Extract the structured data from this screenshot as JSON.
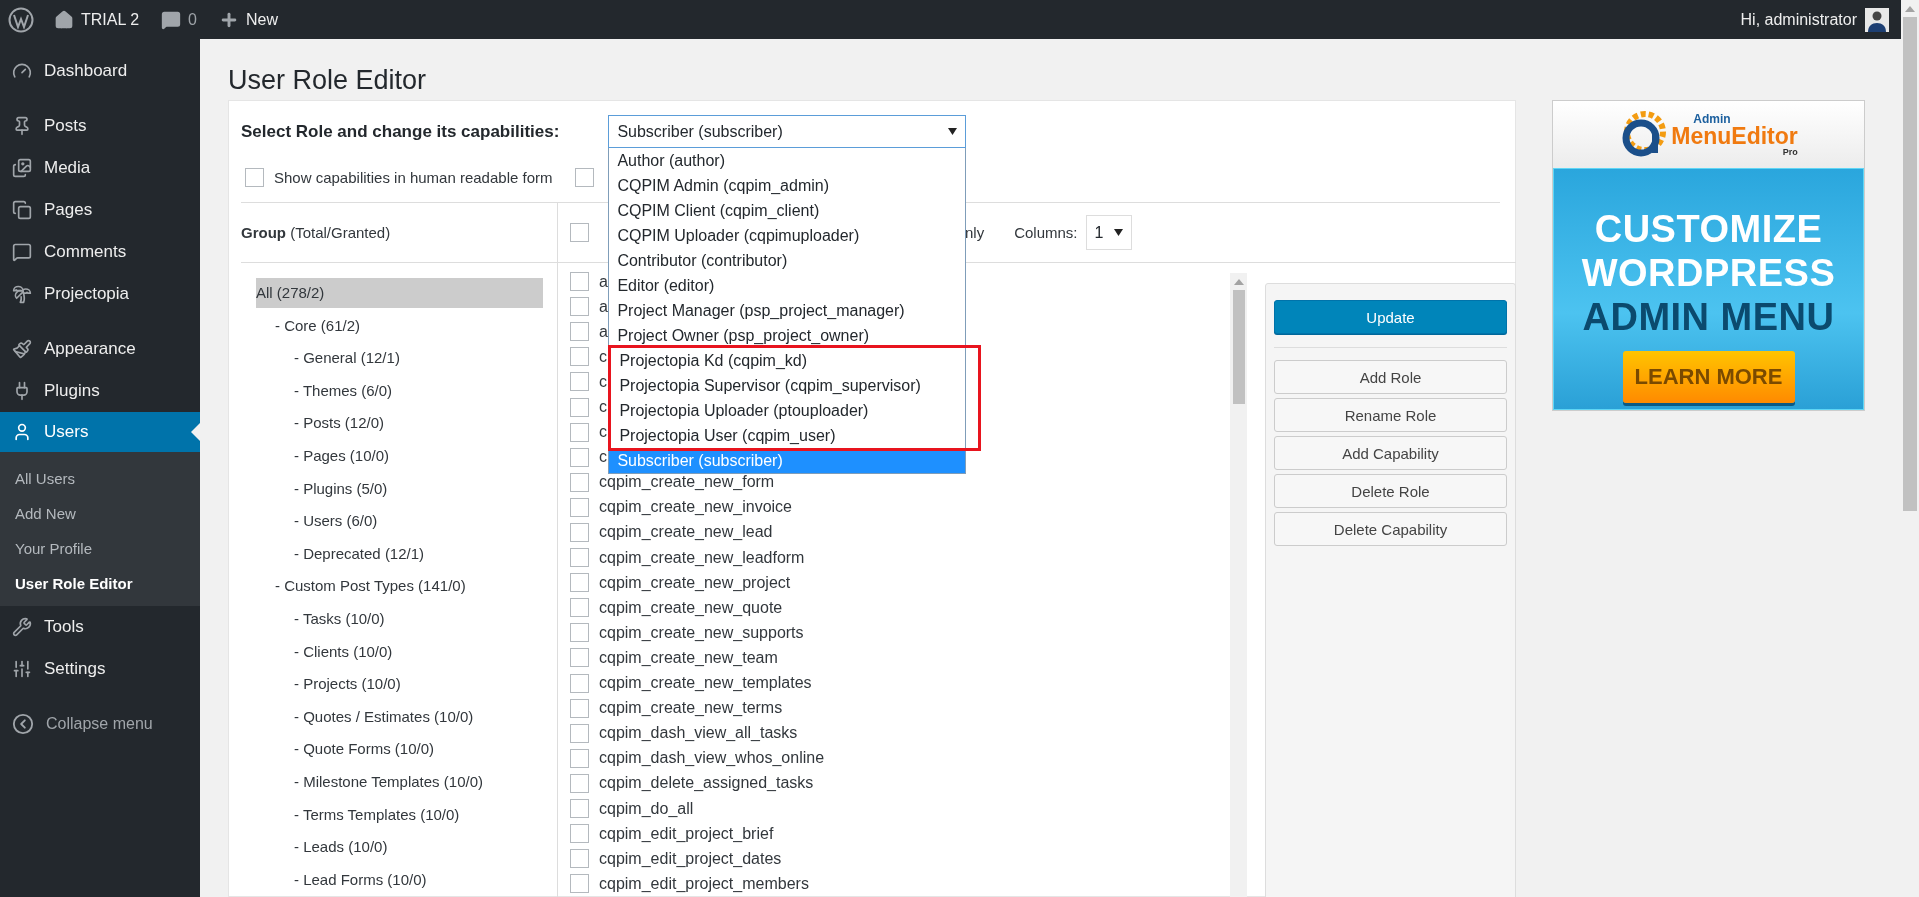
{
  "top_bar": {
    "site": "TRIAL 2",
    "comments": "0",
    "new": "New",
    "greeting": "Hi, administrator"
  },
  "sidebar": {
    "groups": [
      {
        "items": [
          {
            "label": "Dashboard",
            "selected": false
          }
        ]
      },
      {
        "items": [
          {
            "label": "Posts",
            "selected": false
          },
          {
            "label": "Media",
            "selected": false
          },
          {
            "label": "Pages",
            "selected": false
          },
          {
            "label": "Comments",
            "selected": false
          },
          {
            "label": "Projectopia",
            "selected": false
          }
        ]
      },
      {
        "items": [
          {
            "label": "Appearance",
            "selected": false
          },
          {
            "label": "Plugins",
            "selected": false
          },
          {
            "label": "Users",
            "selected": true,
            "children": [
              {
                "label": "All Users",
                "selected": false
              },
              {
                "label": "Add New",
                "selected": false
              },
              {
                "label": "Your Profile",
                "selected": false
              },
              {
                "label": "User Role Editor",
                "selected": true
              }
            ]
          },
          {
            "label": "Tools",
            "selected": false
          },
          {
            "label": "Settings",
            "selected": false
          }
        ]
      }
    ],
    "collapse": "Collapse menu"
  },
  "page": {
    "title": "User Role Editor"
  },
  "role_select": {
    "label": "Select Role and change its capabilities:",
    "value": "Subscriber (subscriber)",
    "expanded": true,
    "options": [
      {
        "label": "Author (author)",
        "selected": false,
        "highlighted": false
      },
      {
        "label": "CQPIM Admin (cqpim_admin)",
        "selected": false,
        "highlighted": false
      },
      {
        "label": "CQPIM Client (cqpim_client)",
        "selected": false,
        "highlighted": false
      },
      {
        "label": "CQPIM Uploader (cqpimuploader)",
        "selected": false,
        "highlighted": false
      },
      {
        "label": "Contributor (contributor)",
        "selected": false,
        "highlighted": false
      },
      {
        "label": "Editor (editor)",
        "selected": false,
        "highlighted": false
      },
      {
        "label": "Project Manager (psp_project_manager)",
        "selected": false,
        "highlighted": false
      },
      {
        "label": "Project Owner (psp_project_owner)",
        "selected": false,
        "highlighted": false
      },
      {
        "label": "Projectopia Kd (cqpim_kd)",
        "selected": false,
        "highlighted": true
      },
      {
        "label": "Projectopia Supervisor (cqpim_supervisor)",
        "selected": false,
        "highlighted": true
      },
      {
        "label": "Projectopia Uploader (ptouploader)",
        "selected": false,
        "highlighted": true
      },
      {
        "label": "Projectopia User (cqpim_user)",
        "selected": false,
        "highlighted": true
      },
      {
        "label": "Subscriber (subscriber)",
        "selected": true,
        "highlighted": false
      }
    ]
  },
  "options": [
    {
      "label": "Show capabilities in human readable form",
      "checked": false
    },
    {
      "checked": false
    }
  ],
  "groups": {
    "heading": "**Group** (Total/Granted)",
    "items": [
      {
        "label": "All (278/2)",
        "selected": true,
        "children": [
          {
            "label": "- Core (61/2)",
            "selected": false,
            "children": [
              {
                "label": "- General (12/1)",
                "selected": false
              },
              {
                "label": "- Themes (6/0)",
                "selected": false
              },
              {
                "label": "- Posts (12/0)",
                "selected": false
              },
              {
                "label": "- Pages (10/0)",
                "selected": false
              },
              {
                "label": "- Plugins (5/0)",
                "selected": false
              },
              {
                "label": "- Users (6/0)",
                "selected": false
              },
              {
                "label": "- Deprecated (12/1)",
                "selected": false
              }
            ]
          },
          {
            "label": "- Custom Post Types (141/0)",
            "selected": false,
            "children": [
              {
                "label": "- Tasks (10/0)",
                "selected": false
              },
              {
                "label": "- Clients (10/0)",
                "selected": false
              },
              {
                "label": "- Projects (10/0)",
                "selected": false
              },
              {
                "label": "- Quotes / Estimates (10/0)",
                "selected": false
              },
              {
                "label": "- Quote Forms (10/0)",
                "selected": false
              },
              {
                "label": "- Milestone Templates (10/0)",
                "selected": false
              },
              {
                "label": "- Terms Templates (10/0)",
                "selected": false
              },
              {
                "label": "- Leads (10/0)",
                "selected": false
              },
              {
                "label": "- Lead Forms (10/0)",
                "selected": false
              }
            ]
          }
        ]
      }
    ]
  },
  "capabilities_header": {
    "checked": false,
    "text": "nly",
    "columns_label": "Columns:",
    "columns_value": "1"
  },
  "capabilities": [
    {
      "label": "a",
      "checked": false
    },
    {
      "label": "a",
      "checked": false
    },
    {
      "label": "a",
      "checked": false
    },
    {
      "label": "c",
      "checked": false
    },
    {
      "label": "c",
      "checked": false
    },
    {
      "label": "c",
      "checked": false
    },
    {
      "label": "c",
      "checked": false
    },
    {
      "label": "c",
      "checked": false
    },
    {
      "label": "cqpim_create_new_form",
      "checked": false
    },
    {
      "label": "cqpim_create_new_invoice",
      "checked": false
    },
    {
      "label": "cqpim_create_new_lead",
      "checked": false
    },
    {
      "label": "cqpim_create_new_leadform",
      "checked": false
    },
    {
      "label": "cqpim_create_new_project",
      "checked": false
    },
    {
      "label": "cqpim_create_new_quote",
      "checked": false
    },
    {
      "label": "cqpim_create_new_supports",
      "checked": false
    },
    {
      "label": "cqpim_create_new_team",
      "checked": false
    },
    {
      "label": "cqpim_create_new_templates",
      "checked": false
    },
    {
      "label": "cqpim_create_new_terms",
      "checked": false
    },
    {
      "label": "cqpim_dash_view_all_tasks",
      "checked": false
    },
    {
      "label": "cqpim_dash_view_whos_online",
      "checked": false
    },
    {
      "label": "cqpim_delete_assigned_tasks",
      "checked": false
    },
    {
      "label": "cqpim_do_all",
      "checked": false
    },
    {
      "label": "cqpim_edit_project_brief",
      "checked": false
    },
    {
      "label": "cqpim_edit_project_dates",
      "checked": false
    },
    {
      "label": "cqpim_edit_project_members",
      "checked": false
    }
  ],
  "actions": [
    {
      "label": "Update",
      "kind": "primary"
    },
    {
      "label": "Add Role",
      "kind": "secondary"
    },
    {
      "label": "Rename Role",
      "kind": "secondary"
    },
    {
      "label": "Add Capability",
      "kind": "secondary"
    },
    {
      "label": "Delete Role",
      "kind": "secondary"
    },
    {
      "label": "Delete Capability",
      "kind": "secondary"
    }
  ],
  "ad": {
    "brand_small": "Admin",
    "brand": "MenuEditor",
    "brand_sub": "Pro",
    "lines": [
      "CUSTOMIZE",
      "WORDPRESS"
    ],
    "line_dark": "ADMIN MENU",
    "button": "LEARN MORE"
  }
}
